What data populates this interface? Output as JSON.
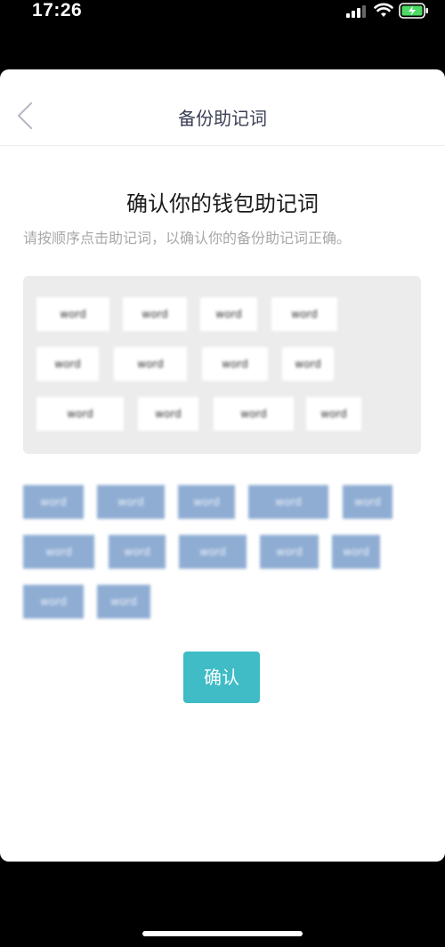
{
  "status_bar": {
    "time": "17:26"
  },
  "nav": {
    "title": "备份助记词",
    "back_icon": "chevron-left-icon"
  },
  "heading": "确认你的钱包助记词",
  "subheading": "请按顺序点击助记词，以确认你的备份助记词正确。",
  "selected_words": [
    "word",
    "word",
    "word",
    "word",
    "word",
    "word",
    "word",
    "word",
    "word",
    "word",
    "word",
    "word"
  ],
  "pool_words": [
    "word",
    "word",
    "word",
    "word",
    "word",
    "word",
    "word",
    "word",
    "word",
    "word",
    "word",
    "word"
  ],
  "confirm_label": "确认",
  "colors": {
    "accent": "#3fbcc5",
    "pool_chip": "#8fadd3",
    "selected_area": "#ececec"
  }
}
